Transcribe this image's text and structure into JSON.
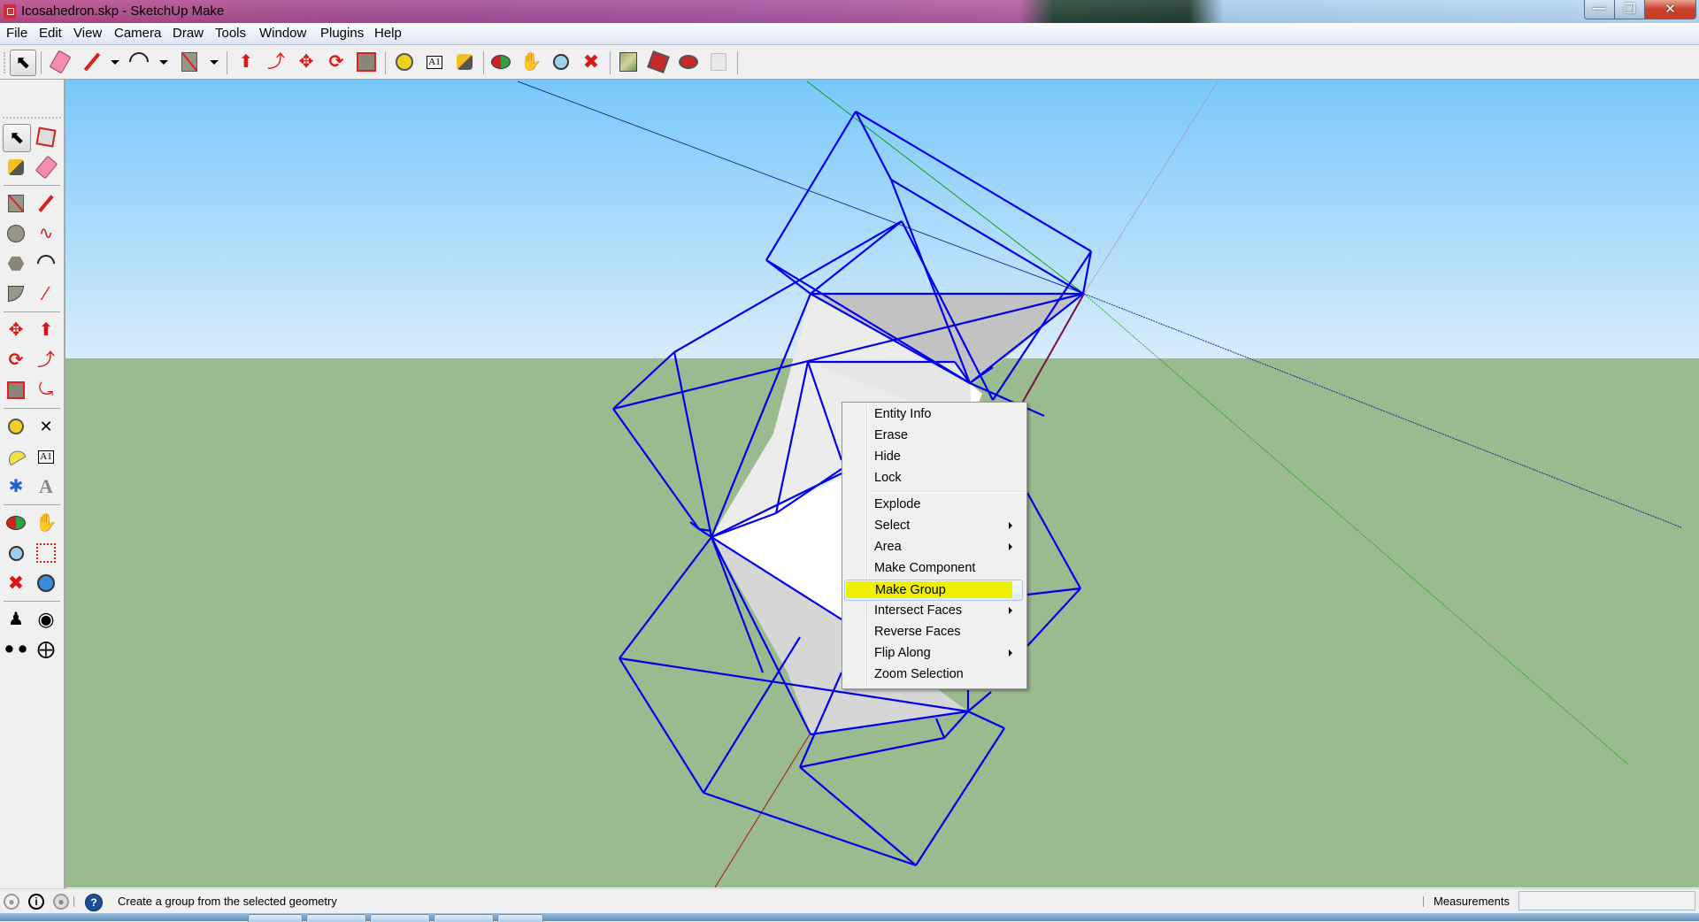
{
  "window": {
    "title": "Icosahedron.skp - SketchUp Make",
    "controls": {
      "minimize": "minimize",
      "restore": "restore",
      "close": "close"
    }
  },
  "menubar": [
    "File",
    "Edit",
    "View",
    "Camera",
    "Draw",
    "Tools",
    "Window",
    "Plugins",
    "Help"
  ],
  "toolbar": {
    "items": [
      {
        "name": "select-tool",
        "icon": "arrow-cursor-icon",
        "active": true
      },
      {
        "name": "eraser-tool",
        "icon": "eraser-icon"
      },
      {
        "name": "line-tool",
        "icon": "pencil-icon",
        "dropdown": true
      },
      {
        "name": "arc-tool",
        "icon": "arc-icon",
        "dropdown": true
      },
      {
        "name": "rectangle-tool",
        "icon": "rectangle-icon",
        "dropdown": true
      },
      {
        "name": "push-pull-tool",
        "icon": "push-pull-icon"
      },
      {
        "name": "follow-me-tool",
        "icon": "follow-me-icon"
      },
      {
        "name": "move-tool",
        "icon": "move-icon"
      },
      {
        "name": "rotate-tool",
        "icon": "rotate-icon"
      },
      {
        "name": "scale-tool",
        "icon": "scale-icon"
      },
      {
        "name": "tape-measure-tool",
        "icon": "tape-measure-icon"
      },
      {
        "name": "text-tool",
        "icon": "text-label-icon"
      },
      {
        "name": "paint-bucket-tool",
        "icon": "paint-bucket-icon"
      },
      {
        "name": "orbit-tool",
        "icon": "orbit-icon"
      },
      {
        "name": "pan-tool",
        "icon": "hand-icon"
      },
      {
        "name": "zoom-tool",
        "icon": "magnifier-icon"
      },
      {
        "name": "zoom-extents-tool",
        "icon": "zoom-extents-icon"
      },
      {
        "name": "add-location-tool",
        "icon": "map-icon"
      },
      {
        "name": "3d-warehouse-tool",
        "icon": "warehouse-icon"
      },
      {
        "name": "share-model-tool",
        "icon": "share-model-icon"
      },
      {
        "name": "share-component-tool",
        "icon": "share-component-icon",
        "disabled": true
      }
    ]
  },
  "left_toolbar": {
    "rows": [
      [
        "select-tool",
        "make-component-tool"
      ],
      [
        "paint-bucket-tool",
        "eraser-tool"
      ],
      [
        "rectangle-tool",
        "line-tool"
      ],
      [
        "circle-tool",
        "freehand-tool"
      ],
      [
        "polygon-tool",
        "arc-tool"
      ],
      [
        "pie-tool",
        "two-point-arc-tool"
      ],
      [
        "move-tool",
        "push-pull-tool"
      ],
      [
        "rotate-tool",
        "follow-me-tool"
      ],
      [
        "scale-tool",
        "offset-tool"
      ],
      [
        "tape-measure-tool",
        "dimension-tool"
      ],
      [
        "protractor-tool",
        "text-tool"
      ],
      [
        "axes-tool",
        "3d-text-tool"
      ],
      [
        "orbit-tool",
        "pan-tool"
      ],
      [
        "zoom-tool",
        "zoom-window-tool"
      ],
      [
        "zoom-extents-tool",
        "previous-view-tool"
      ],
      [
        "position-camera-tool",
        "look-around-tool"
      ],
      [
        "walk-tool",
        "section-plane-tool"
      ]
    ]
  },
  "context_menu": {
    "groups": [
      [
        {
          "label": "Entity Info"
        },
        {
          "label": "Erase"
        },
        {
          "label": "Hide"
        },
        {
          "label": "Lock"
        }
      ],
      [
        {
          "label": "Explode"
        },
        {
          "label": "Select",
          "submenu": true
        },
        {
          "label": "Area",
          "submenu": true
        },
        {
          "label": "Make Component"
        },
        {
          "label": "Make Group",
          "highlighted": true
        },
        {
          "label": "Intersect Faces",
          "submenu": true
        },
        {
          "label": "Reverse Faces"
        },
        {
          "label": "Flip Along",
          "submenu": true
        },
        {
          "label": "Zoom Selection"
        }
      ]
    ]
  },
  "statusbar": {
    "hint": "Create a group from the selected geometry",
    "measurements_label": "Measurements",
    "measurements_value": ""
  },
  "colors": {
    "sky_top": "#79c8fb",
    "sky_bottom": "#d8ecfb",
    "ground": "#99bb8f",
    "selected_edge": "#0000ee",
    "face_light": "#ececec",
    "face_shade": "#c2c2c2",
    "highlight": "#eef000",
    "axis_red": "#b01010",
    "axis_green": "#10a010",
    "axis_blue": "#1a2aa0"
  }
}
